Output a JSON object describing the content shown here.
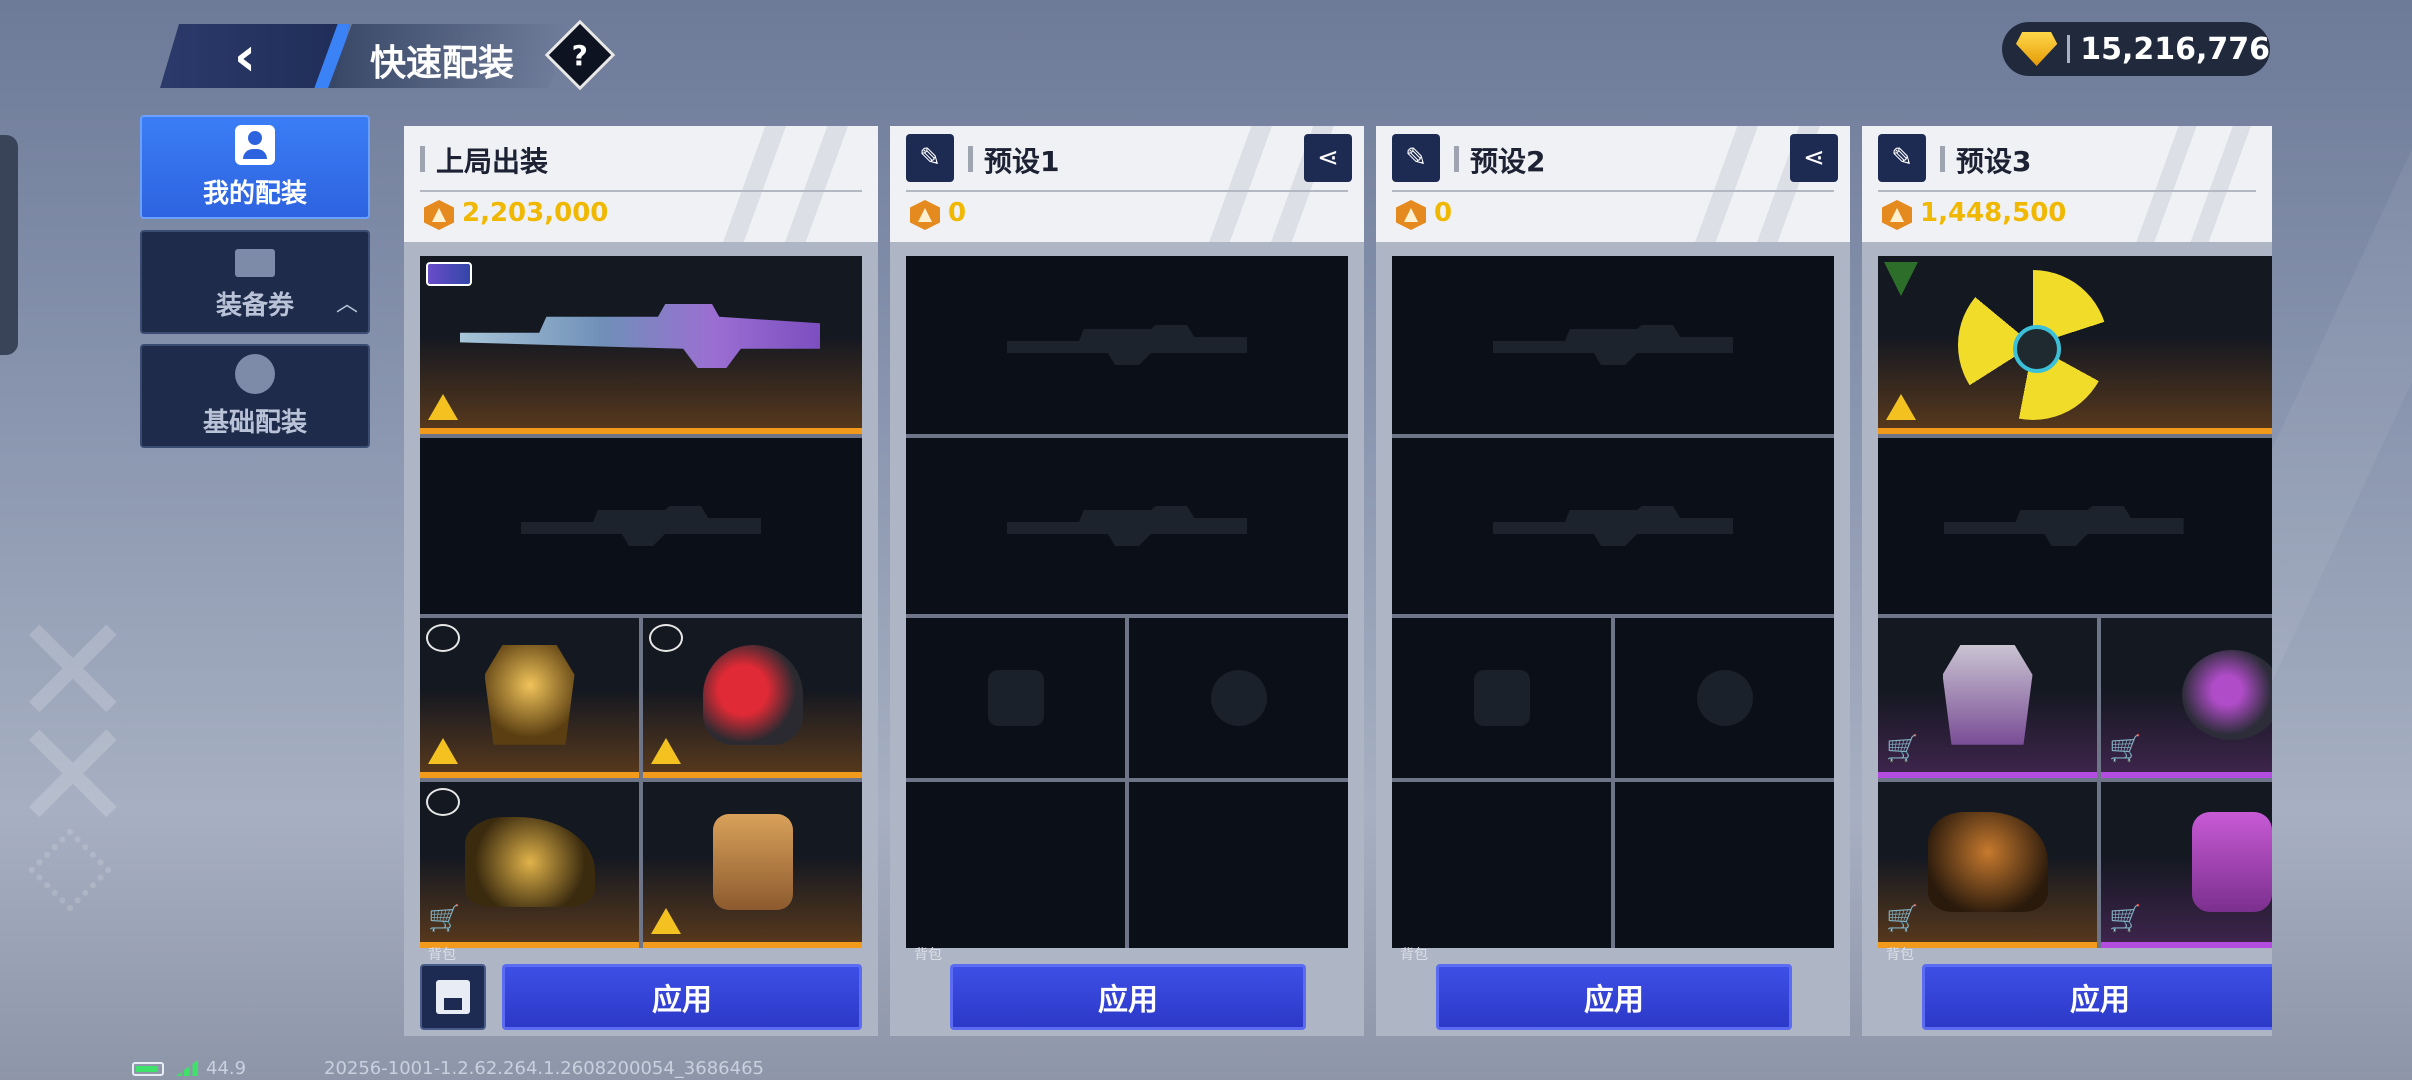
{
  "header": {
    "title": "快速配装",
    "help_symbol": "?"
  },
  "currency": {
    "icon": "gem-icon",
    "amount": "15,216,776"
  },
  "nav": {
    "items": [
      {
        "label": "我的配装",
        "icon": "profile-icon",
        "active": true
      },
      {
        "label": "装备券",
        "icon": "ticket-icon",
        "active": false
      },
      {
        "label": "基础配装",
        "icon": "hand-icon",
        "active": false
      }
    ]
  },
  "presets": [
    {
      "name": "上局出装",
      "value": "2,203,000",
      "editable": false,
      "shareable": false,
      "apply_label": "应用",
      "slot_caption": "背包"
    },
    {
      "name": "预设1",
      "value": "0",
      "editable": true,
      "shareable": true,
      "apply_label": "应用",
      "slot_caption": "背包"
    },
    {
      "name": "预设2",
      "value": "0",
      "editable": true,
      "shareable": true,
      "apply_label": "应用",
      "slot_caption": "背包"
    },
    {
      "name": "预设3",
      "value": "1,448,500",
      "editable": true,
      "shareable": false,
      "apply_label": "应用",
      "slot_caption": "背包"
    }
  ],
  "colors": {
    "accent_blue": "#3a7df5",
    "apply_button": "#3d4fe6",
    "value_gold": "#f0b800",
    "rarity_orange": "#f29a1c",
    "rarity_purple": "#b24de0"
  },
  "status": {
    "fps": "44.9",
    "build": "20256-1001-1.2.62.264.1.2608200054_3686465"
  }
}
